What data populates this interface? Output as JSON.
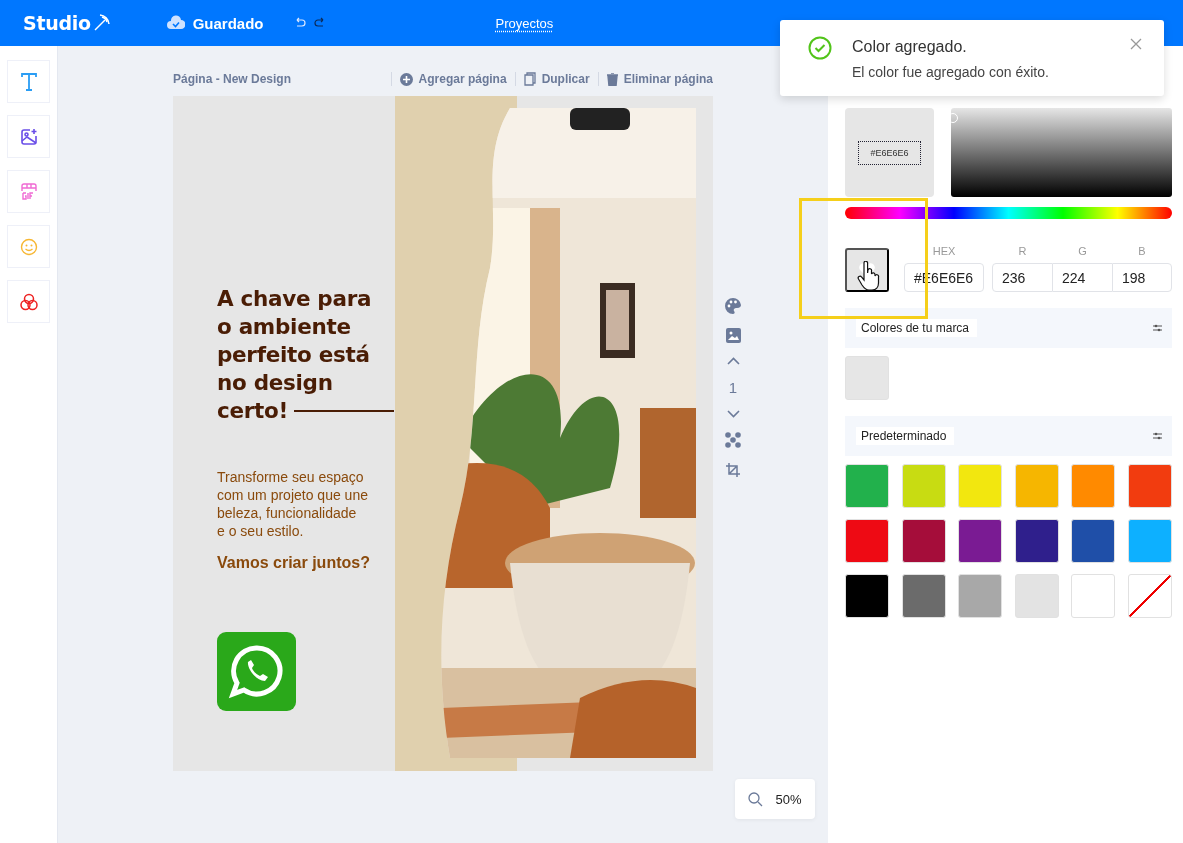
{
  "topbar": {
    "logo": "Studio",
    "status": "Guardado",
    "center_link": "Proyectos"
  },
  "page": {
    "title": "Página - New Design",
    "actions": [
      "Agregar página",
      "Duplicar",
      "Eliminar página"
    ]
  },
  "design": {
    "headline": "A chave para\no ambiente\nperfeito está\nno design",
    "headline_end": "certo!",
    "body": "Transforme seu espaço\ncom um projeto que une\nbeleza, funcionalidade\ne o seu estilo.",
    "cta": "Vamos criar juntos?"
  },
  "page_nav": {
    "number": "1"
  },
  "zoom": "50%",
  "color_picker": {
    "preview_hex": "#E6E6E6",
    "labels": [
      "HEX",
      "R",
      "G",
      "B"
    ],
    "hex": "#E6E6E6",
    "r": "236",
    "g": "224",
    "b": "198"
  },
  "brand_colors": {
    "title": "Colores de tu marca",
    "swatches": [
      {
        "kind": "color",
        "color": "#e6e6e6"
      }
    ]
  },
  "default_colors": {
    "title": "Predeterminado",
    "swatches": [
      {
        "kind": "color",
        "color": "#22b14c"
      },
      {
        "kind": "color",
        "color": "#c8dc12"
      },
      {
        "kind": "color",
        "color": "#f2e70f"
      },
      {
        "kind": "color",
        "color": "#f6b600"
      },
      {
        "kind": "color",
        "color": "#ff8a00"
      },
      {
        "kind": "color",
        "color": "#f23c0f"
      },
      {
        "kind": "color",
        "color": "#ee0a14"
      },
      {
        "kind": "color",
        "color": "#a50d3a"
      },
      {
        "kind": "color",
        "color": "#7a1b93"
      },
      {
        "kind": "color",
        "color": "#2f1f8c"
      },
      {
        "kind": "color",
        "color": "#1f4fa8"
      },
      {
        "kind": "color",
        "color": "#0db0ff"
      },
      {
        "kind": "color",
        "color": "#000000"
      },
      {
        "kind": "color",
        "color": "#6b6b6b"
      },
      {
        "kind": "color",
        "color": "#a8a8a8"
      },
      {
        "kind": "color",
        "color": "#e3e3e3"
      },
      {
        "kind": "color",
        "color": "#ffffff"
      },
      {
        "kind": "none"
      }
    ]
  },
  "toast": {
    "title": "Color agregado.",
    "message": "El color fue agregado con éxito."
  }
}
